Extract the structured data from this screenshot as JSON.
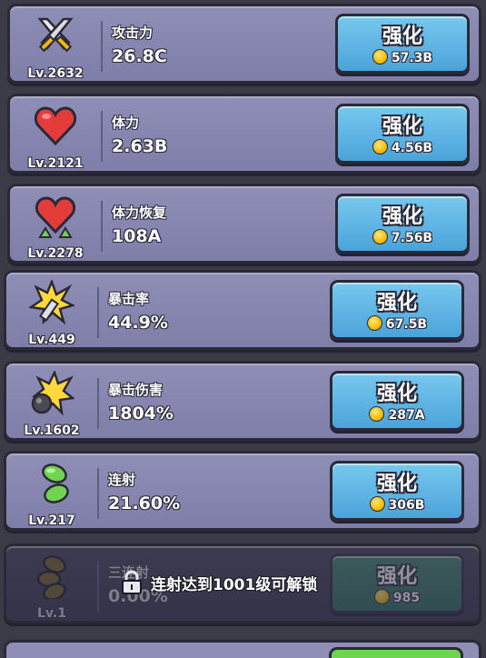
{
  "upgrades": [
    {
      "icon": "sword-icon",
      "level": "Lv.2632",
      "name": "攻击力",
      "value": "26.8C",
      "button": "强化",
      "cost": "57.3B"
    },
    {
      "icon": "heart-icon",
      "level": "Lv.2121",
      "name": "体力",
      "value": "2.63B",
      "button": "强化",
      "cost": "4.56B"
    },
    {
      "icon": "heart-recovery-icon",
      "level": "Lv.2278",
      "name": "体力恢复",
      "value": "108A",
      "button": "强化",
      "cost": "7.56B"
    },
    {
      "icon": "critical-rate-icon",
      "level": "Lv.449",
      "name": "暴击率",
      "value": "44.9%",
      "button": "强化",
      "cost": "67.5B"
    },
    {
      "icon": "critical-damage-icon",
      "level": "Lv.1602",
      "name": "暴击伤害",
      "value": "1804%",
      "button": "强化",
      "cost": "287A"
    },
    {
      "icon": "multishot-icon",
      "level": "Lv.217",
      "name": "连射",
      "value": "21.60%",
      "button": "强化",
      "cost": "306B"
    },
    {
      "icon": "triple-shot-icon",
      "level": "Lv.1",
      "name": "三连射",
      "value": "0.00%",
      "button": "强化",
      "cost": "985",
      "locked": true
    }
  ],
  "lock_message": "连射达到1001级可解锁",
  "colors": {
    "panel": "#8f8eb7",
    "button": "#4aa3d9",
    "background": "#3b3a47",
    "coin": "#f2b705"
  }
}
